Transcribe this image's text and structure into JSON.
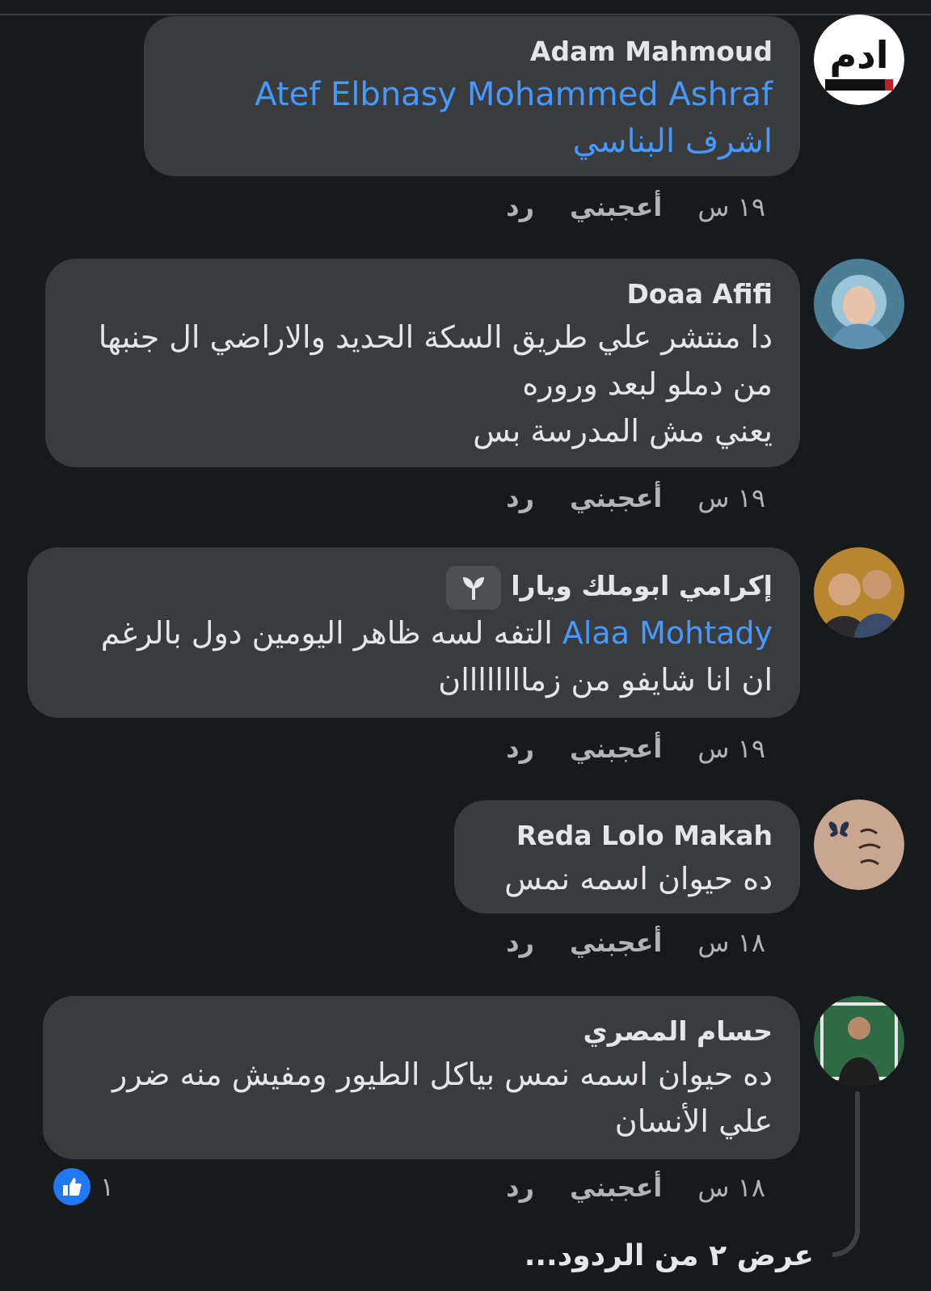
{
  "comments": [
    {
      "author": "Adam Mahmoud",
      "mention": "Atef Elbnasy Mohammed Ashraf اشرف البناسي",
      "text": "",
      "time": "١٩ س",
      "like_label": "أعجبني",
      "reply_label": "رد",
      "avatar": "adam-logo-avatar"
    },
    {
      "author": "Doaa Afifi",
      "text": "دا منتشر علي طريق السكة الحديد والاراضي ال جنبها\nمن دملو لبعد وروره\nيعني مش المدرسة بس",
      "time": "١٩ س",
      "like_label": "أعجبني",
      "reply_label": "رد",
      "avatar": "hijab-woman-avatar"
    },
    {
      "author": "إكرامي ابوملك ويارا",
      "badge_icon": "new-member-sprout-icon",
      "mention": "Alaa Mohtady",
      "text": "التفه لسه ظاهر اليومين دول بالرغم\nان انا شايفو من زماااااااان",
      "time": "١٩ س",
      "like_label": "أعجبني",
      "reply_label": "رد",
      "avatar": "two-people-avatar"
    },
    {
      "author": "Reda Lolo Makah",
      "text": "ده حيوان اسمه نمس",
      "time": "١٨ س",
      "like_label": "أعجبني",
      "reply_label": "رد",
      "avatar": "butterfly-calligraphy-avatar"
    },
    {
      "author": "حسام المصري",
      "text": "ده حيوان اسمه نمس بياكل الطيور ومفيش منه ضرر\nعلي الأنسان",
      "time": "١٨ س",
      "like_label": "أعجبني",
      "reply_label": "رد",
      "avatar": "man-standing-avatar",
      "reaction_count": "١",
      "reaction_icon": "thumbs-up-icon"
    }
  ],
  "view_replies": "عرض ٢ من الردود...",
  "colors": {
    "background": "#18191a",
    "bubble": "#3a3b3c",
    "mention": "#4599ff",
    "secondary_text": "#b0b3b8",
    "like_blue": "#2078f4"
  }
}
